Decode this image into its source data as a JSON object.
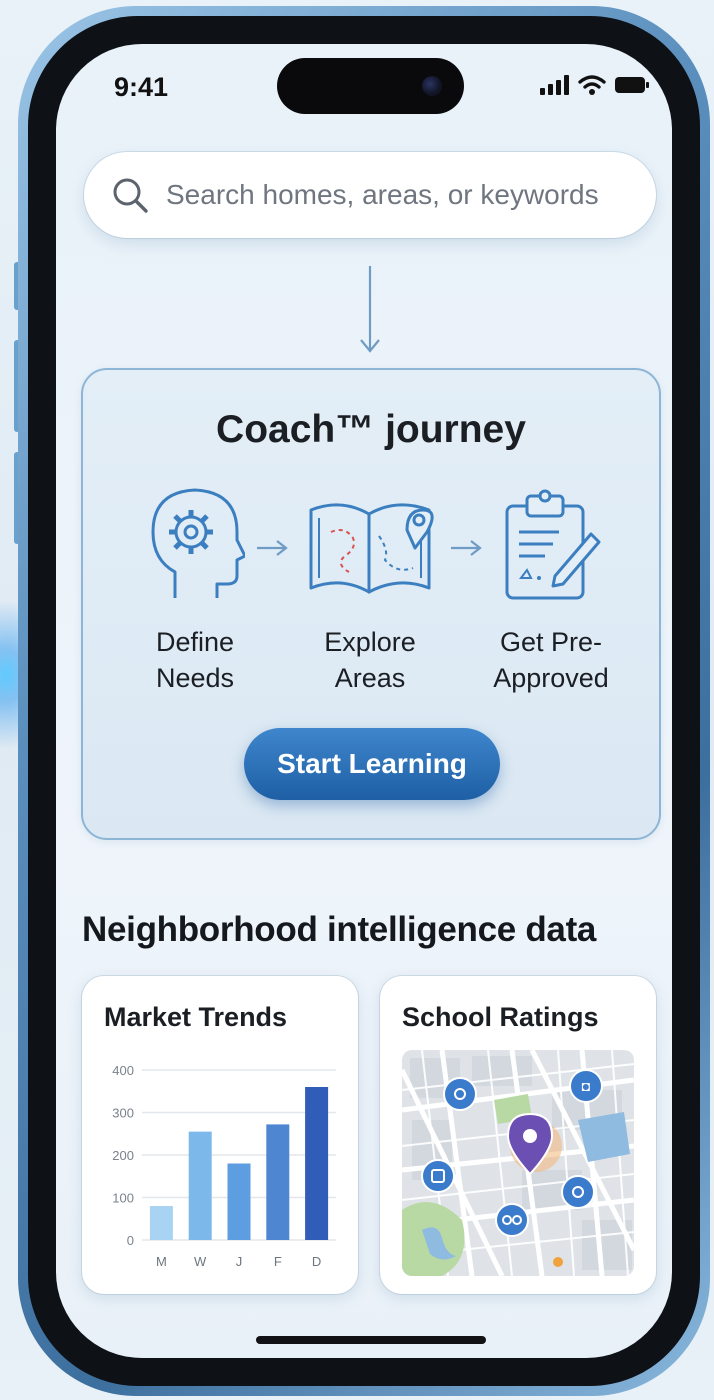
{
  "status_bar": {
    "time": "9:41"
  },
  "search": {
    "placeholder": "Search homes, areas, or keywords"
  },
  "coach": {
    "title": "Coach™ journey",
    "steps": [
      {
        "icon": "head-gear-icon",
        "line1": "Define",
        "line2": "Needs"
      },
      {
        "icon": "map-book-icon",
        "line1": "Explore",
        "line2": "Areas"
      },
      {
        "icon": "clipboard-pen-icon",
        "line1": "Get Pre-",
        "line2": "Approved"
      }
    ],
    "button_label": "Start Learning"
  },
  "section": {
    "title": "Neighborhood intelligence data"
  },
  "market_card": {
    "title": "Market Trends"
  },
  "school_card": {
    "title": "School Ratings"
  },
  "chart_data": {
    "type": "bar",
    "categories": [
      "M",
      "W",
      "J",
      "F",
      "D"
    ],
    "values": [
      80,
      255,
      180,
      272,
      360
    ],
    "yticks": [
      "400",
      "300",
      "200",
      "100",
      "0"
    ],
    "ylim": [
      0,
      400
    ],
    "colors": [
      "#a9d3f2",
      "#7cb9ea",
      "#5c9ee0",
      "#4f86d2",
      "#2f5db8"
    ]
  },
  "colors": {
    "accent": "#2a6fb8",
    "pin": "#6b4fb3"
  }
}
